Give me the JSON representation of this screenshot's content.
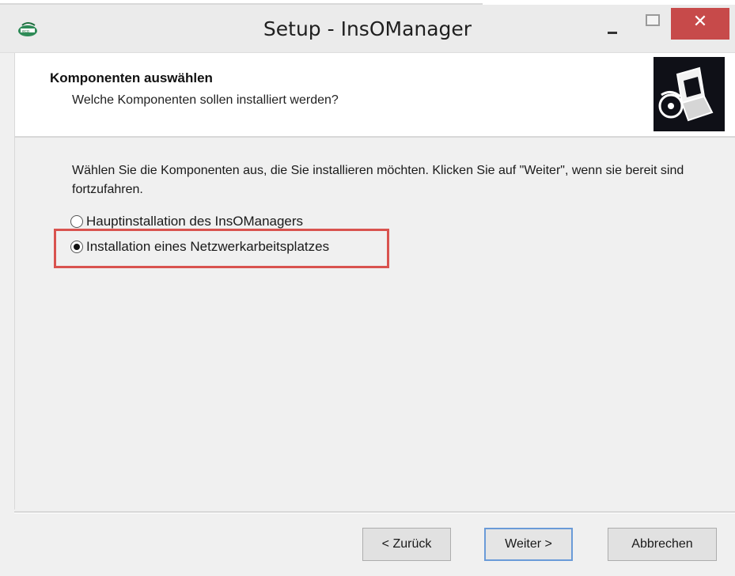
{
  "window": {
    "title": "Setup - InsOManager",
    "close_glyph": "✕"
  },
  "header": {
    "title": "Komponenten auswählen",
    "subtitle": "Welche Komponenten sollen installiert werden?"
  },
  "main": {
    "description": "Wählen Sie die Komponenten aus, die Sie installieren möchten. Klicken Sie auf \"Weiter\", wenn sie bereit sind fortzufahren.",
    "options": [
      {
        "label": "Hauptinstallation des InsOManagers",
        "selected": false
      },
      {
        "label": "Installation eines Netzwerkarbeitsplatzes",
        "selected": true
      }
    ],
    "highlight_color": "#d9534f"
  },
  "footer": {
    "back_label": "< Zurück",
    "next_label": "Weiter >",
    "cancel_label": "Abbrechen"
  },
  "icons": {
    "app": "installer-app-icon",
    "setup": "computer-install-icon"
  }
}
